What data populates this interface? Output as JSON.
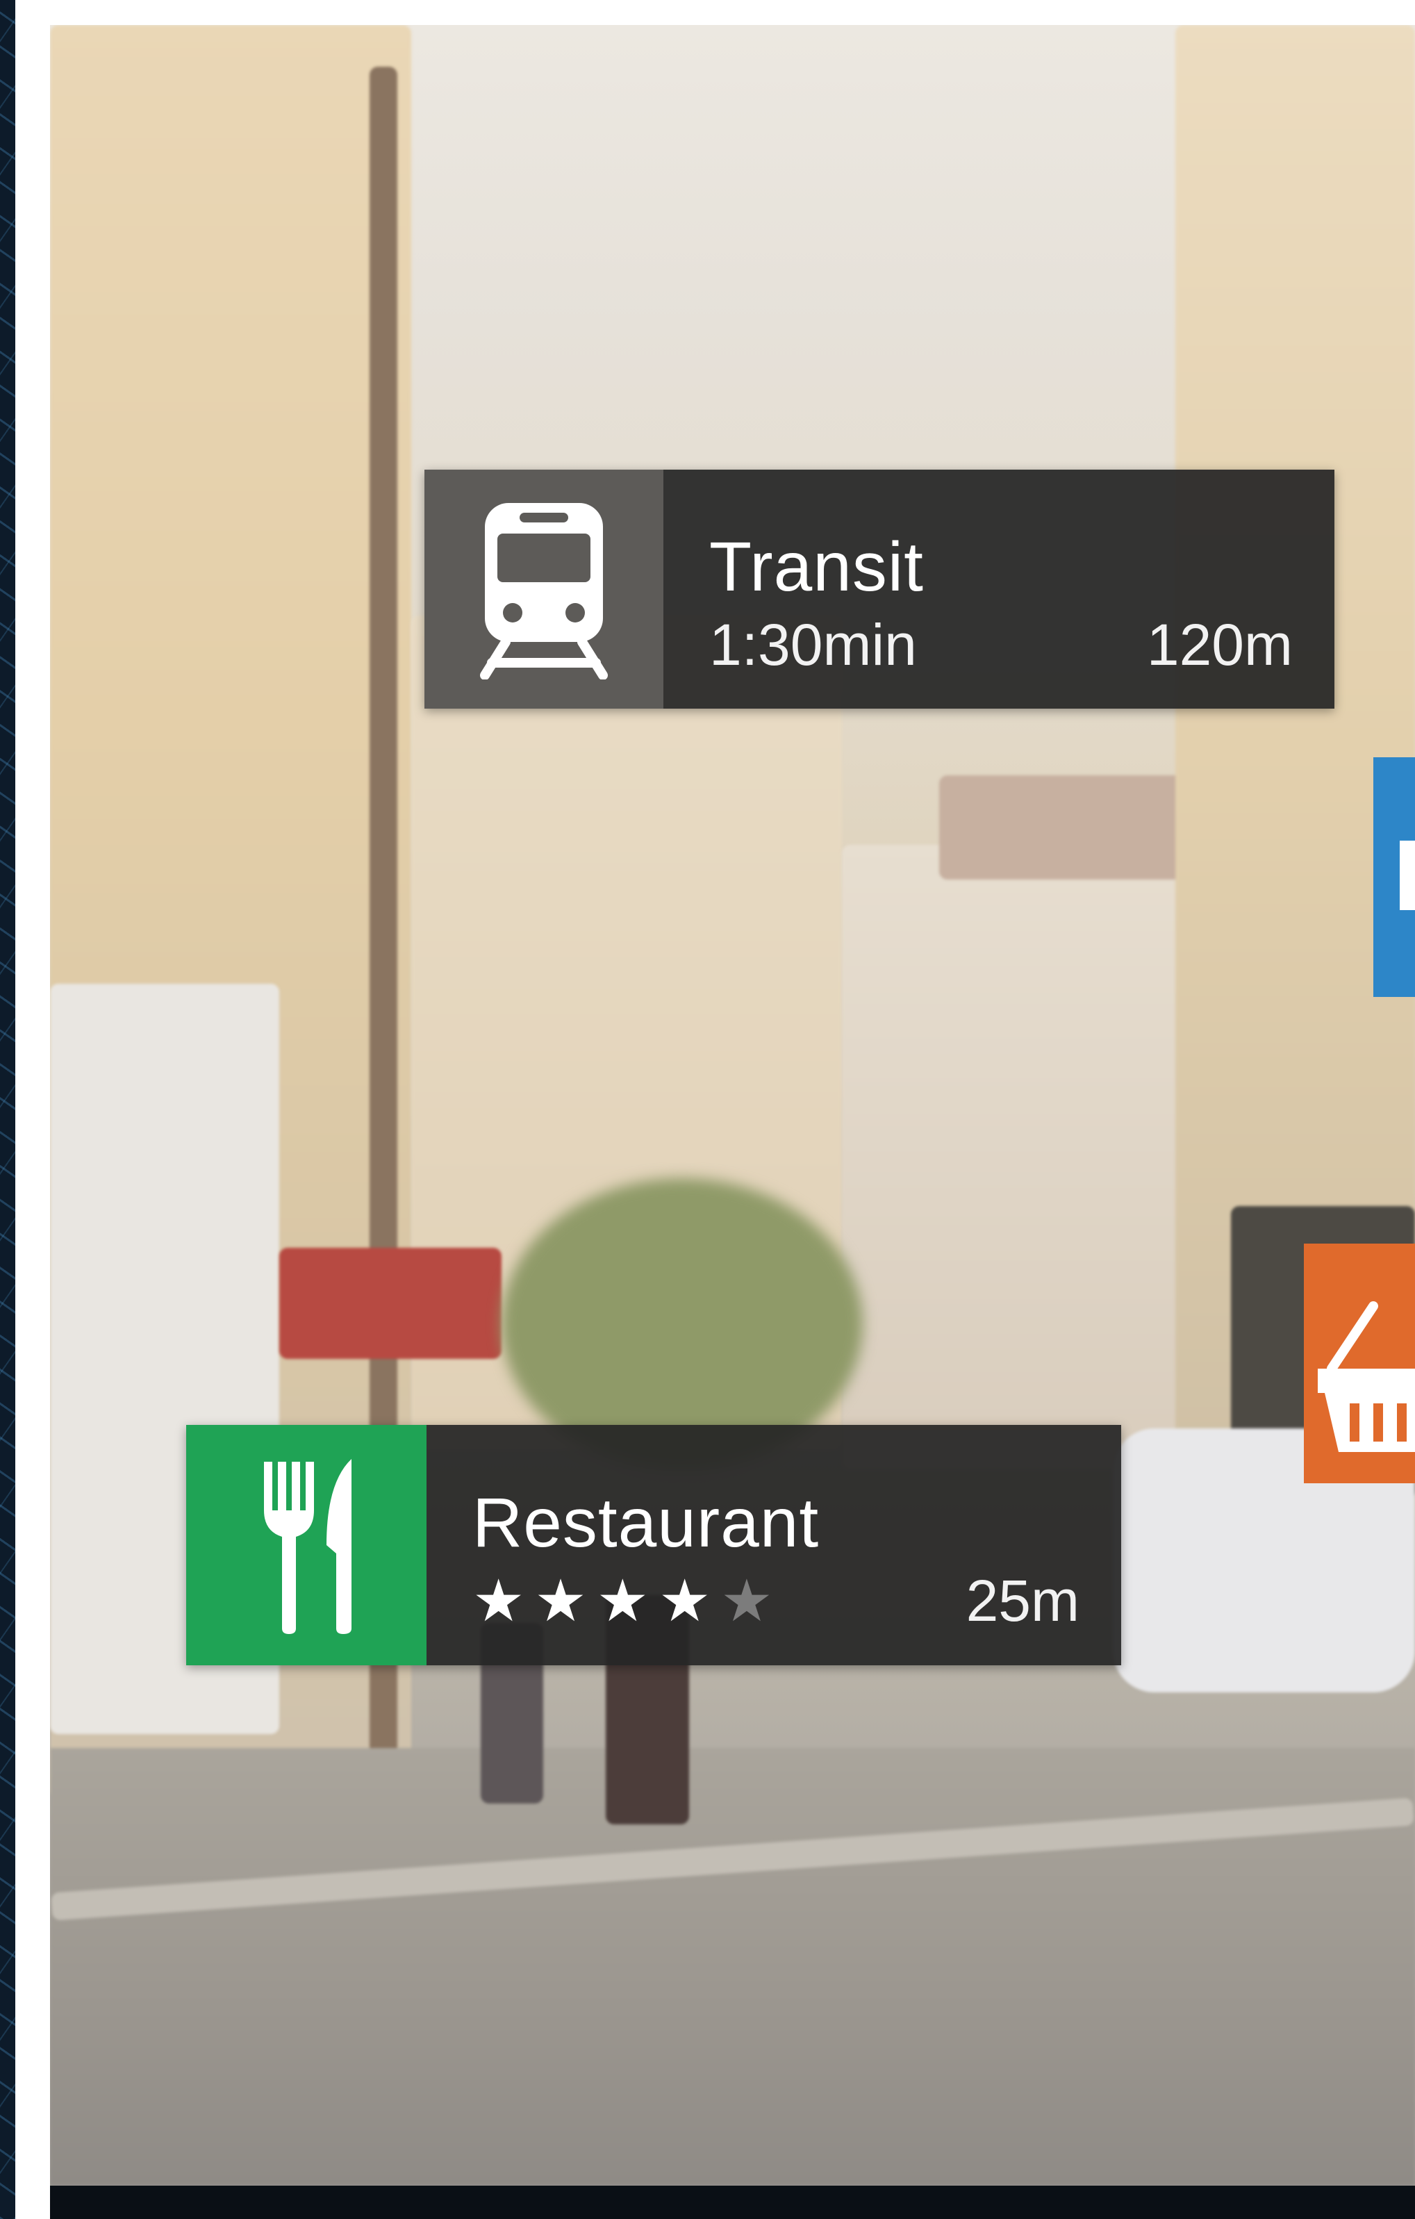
{
  "ar_overlay": {
    "transit": {
      "title": "Transit",
      "duration": "1:30min",
      "distance": "120m",
      "icon": "train-icon",
      "color": "#5d5b58"
    },
    "restaurant": {
      "title": "Restaurant",
      "rating_stars": 4,
      "rating_max": 5,
      "distance": "25m",
      "icon": "fork-knife-icon",
      "color": "#1fa355"
    },
    "partial_cards": [
      {
        "icon": "info-icon",
        "color": "#2d86c8"
      },
      {
        "icon": "shopping-basket-icon",
        "color": "#e06a2c"
      }
    ]
  },
  "colors": {
    "card_background": "#262626",
    "card_text": "#ffffff"
  }
}
